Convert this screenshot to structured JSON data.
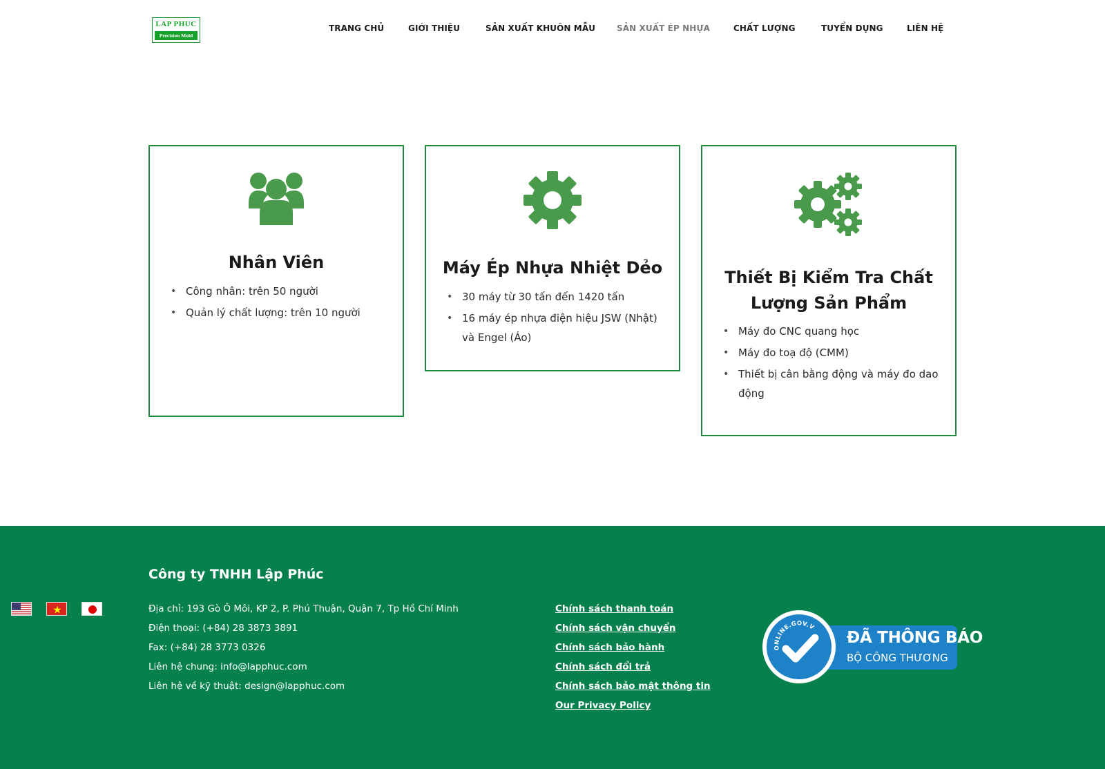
{
  "logo": {
    "line1": "LAP PHUC",
    "line2": "Precision Mold"
  },
  "nav": {
    "items": [
      {
        "label": "TRANG CHỦ",
        "active": false
      },
      {
        "label": "GIỚI THIỆU",
        "active": false
      },
      {
        "label": "SẢN XUẤT KHUÔN MẪU",
        "active": false
      },
      {
        "label": "SẢN XUẤT ÉP NHỰA",
        "active": true
      },
      {
        "label": "CHẤT LƯỢNG",
        "active": false
      },
      {
        "label": "TUYỂN DỤNG",
        "active": false
      },
      {
        "label": "LIÊN HỆ",
        "active": false
      }
    ]
  },
  "cards": [
    {
      "icon": "users-icon",
      "title": "Nhân Viên",
      "items": [
        "Công nhân: trên 50 người",
        "Quản lý chất lượng: trên 10 người"
      ]
    },
    {
      "icon": "gear-icon",
      "title": "Máy Ép Nhựa Nhiệt Dẻo",
      "items": [
        "30 máy từ 30 tấn đến 1420 tấn",
        "16 máy ép nhựa điện hiệu JSW (Nhật) và Engel (Áo)"
      ]
    },
    {
      "icon": "gears-icon",
      "title": "Thiết Bị Kiểm Tra Chất Lượng Sản Phẩm",
      "items": [
        "Máy đo CNC quang học",
        "Máy đo toạ độ (CMM)",
        "Thiết bị cân bằng động và máy đo dao động"
      ]
    }
  ],
  "footer": {
    "company": "Công ty TNHH Lập Phúc",
    "info": [
      "Địa chỉ: 193 Gò Ô Môi, KP 2, P. Phú Thuận, Quận 7, Tp Hồ Chí Minh",
      "Điện thoại: (+84) 28 3873 3891",
      "Fax: (+84) 28 3773 0326",
      "Liên hệ chung: info@lapphuc.com",
      "Liên hệ về kỹ thuật: design@lapphuc.com"
    ],
    "policies": [
      "Chính sách thanh toán",
      "Chính sách vận chuyển",
      "Chính sách bảo hành",
      "Chính sách đổi trả",
      "Chính sách bảo mật thông tin",
      "Our Privacy Policy"
    ],
    "badge": {
      "arc_text": "ONLINE.GOV.VN",
      "line1": "ĐÃ THÔNG BÁO",
      "line2": "BỘ CÔNG THƯƠNG"
    },
    "flags": [
      "us-flag-icon",
      "vn-flag-icon",
      "jp-flag-icon"
    ]
  },
  "colors": {
    "brand_green": "#06804d",
    "icon_green": "#4a9a4b",
    "card_border": "#1f8d3b",
    "badge_blue": "#1e82c8"
  }
}
